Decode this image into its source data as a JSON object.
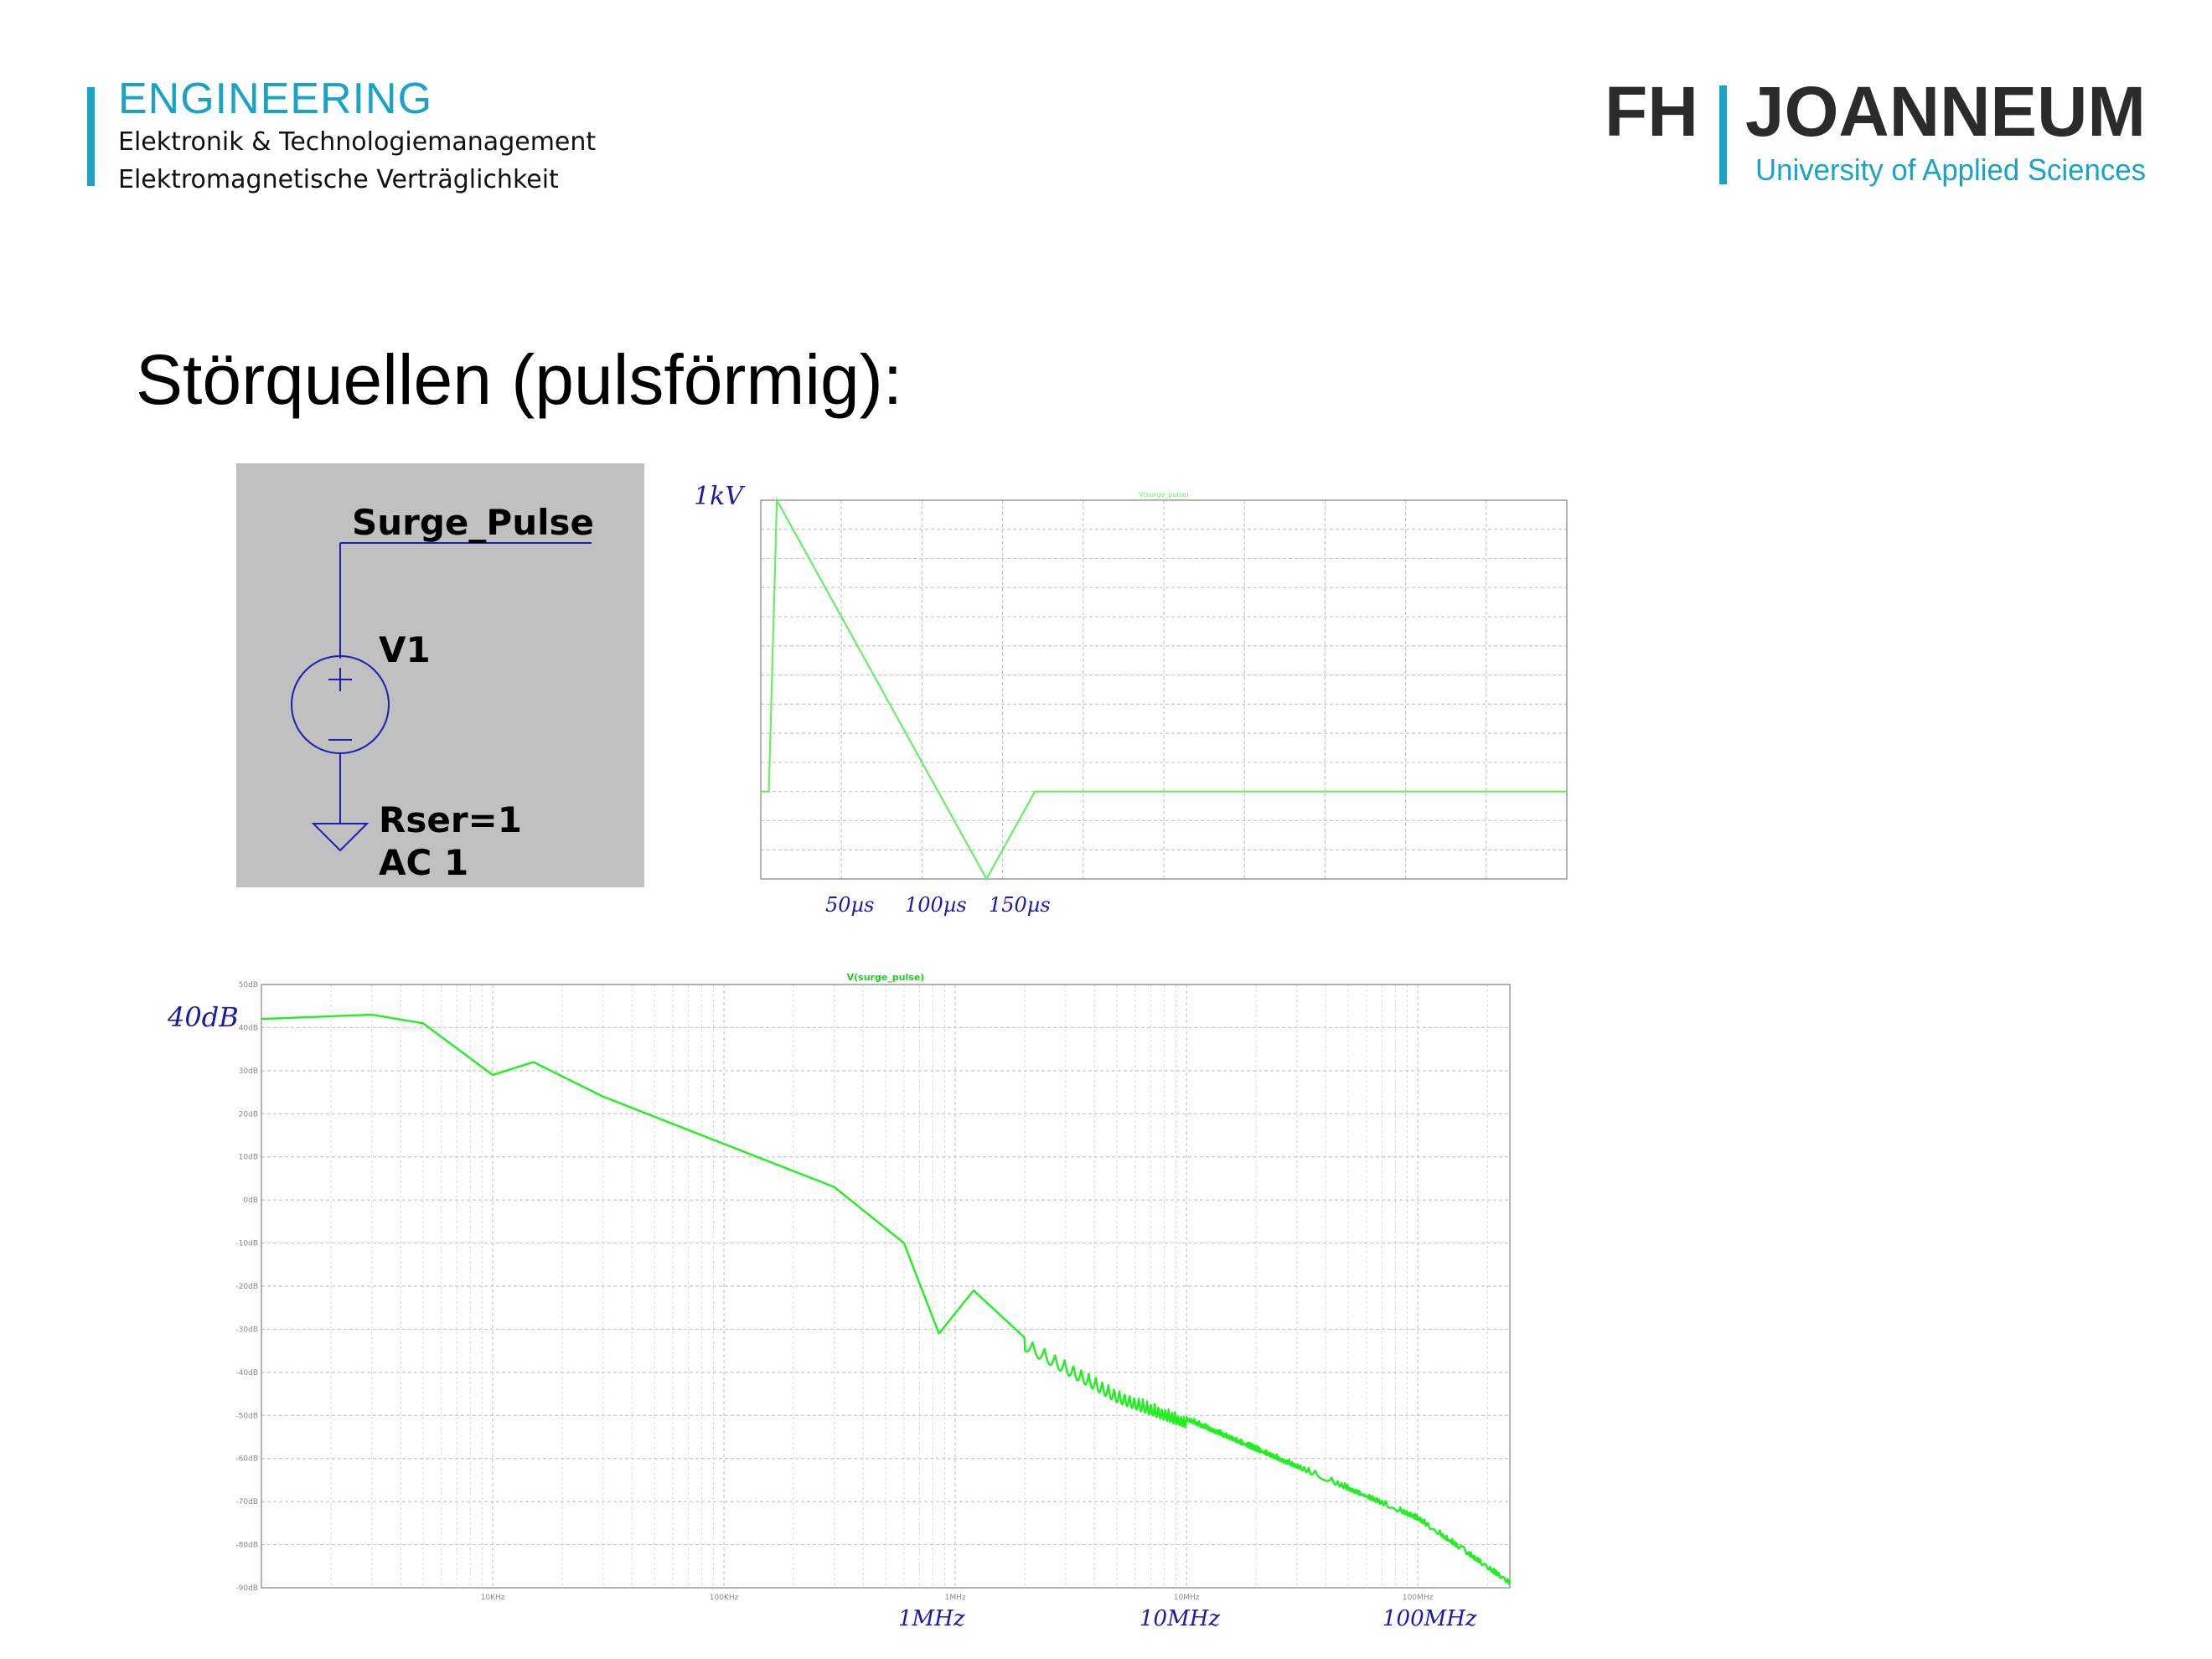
{
  "header": {
    "engineering": "ENGINEERING",
    "line1": "Elektronik & Technologiemanagement",
    "line2": "Elektromagnetische Verträglichkeit"
  },
  "logo": {
    "fh": "FH",
    "joanneum": "JOANNEUM",
    "tagline": "University of Applied Sciences",
    "accent_color": "#1aa3c4",
    "text_color": "#2b2b2b"
  },
  "slide": {
    "title": "Störquellen (pulsförmig):"
  },
  "schematic": {
    "net_label": "Surge_Pulse",
    "source_name": "V1",
    "rser": "Rser=1",
    "ac": "AC 1",
    "wire_color": "#1d1db0"
  },
  "annotations": {
    "transient_peak": "1kV",
    "t50": "50µs",
    "t100": "100µs",
    "t150": "150µs",
    "mag_40db": "40dB",
    "f1mhz": "1MHz",
    "f10mhz": "10MHz",
    "f100mhz": "100MHz"
  },
  "chart_data": [
    {
      "type": "line",
      "title": "V(surge_pulse)",
      "series": [
        {
          "color": "#66ee66",
          "x": [
            0,
            5,
            5,
            10,
            10,
            140,
            170,
            270,
            500
          ],
          "y": [
            0,
            0,
            0,
            1000,
            1000,
            -300,
            0,
            0,
            0
          ]
        }
      ],
      "xlim": [
        0,
        500
      ],
      "ylim": [
        -300,
        1000
      ],
      "grid": true
    },
    {
      "type": "line",
      "title": "V(surge_pulse)",
      "xscale": "log",
      "series": [
        {
          "color": "#22ee22",
          "x": [
            1000,
            3000,
            5000,
            10000,
            15000,
            30000,
            100000,
            300000,
            600000,
            850000,
            1200000,
            2000000,
            5000000,
            10000000,
            100000000,
            250000000
          ],
          "y": [
            42,
            43,
            41,
            29,
            32,
            24,
            13,
            3,
            -10,
            -31,
            -21,
            -32,
            -44,
            -50,
            -73,
            -88
          ]
        }
      ],
      "x_ticks": [
        "10KHz",
        "100KHz",
        "1MHz",
        "10MHz",
        "100MHz"
      ],
      "y_ticks": [
        "50dB",
        "40dB",
        "30dB",
        "20dB",
        "10dB",
        "0dB",
        "-10dB",
        "-20dB",
        "-30dB",
        "-40dB",
        "-50dB",
        "-60dB",
        "-70dB",
        "-80dB",
        "-90dB"
      ],
      "xlim": [
        1000,
        250000000
      ],
      "ylim": [
        -90,
        50
      ],
      "grid": true
    }
  ]
}
